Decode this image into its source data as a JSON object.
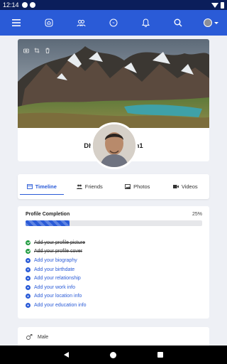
{
  "status": {
    "time": "12:14"
  },
  "appbar": {
    "icons": [
      "menu-icon",
      "home-icon",
      "friends-icon",
      "messenger-icon",
      "notifications-icon",
      "search-icon",
      "profile-menu-icon"
    ]
  },
  "profile": {
    "name": "Dhirendra Mohan1",
    "cover_tools": [
      "camera-icon",
      "crop-icon",
      "delete-icon"
    ]
  },
  "tabs": [
    {
      "label": "Timeline",
      "icon": "timeline-icon",
      "active": true
    },
    {
      "label": "Friends",
      "icon": "friends-icon",
      "active": false
    },
    {
      "label": "Photos",
      "icon": "photos-icon",
      "active": false
    },
    {
      "label": "Videos",
      "icon": "videos-icon",
      "active": false
    }
  ],
  "completion": {
    "title": "Profile Completion",
    "percent_label": "25%",
    "progress": 0.25,
    "items": [
      {
        "label": "Add your profile picture",
        "done": true
      },
      {
        "label": "Add your profile cover",
        "done": true
      },
      {
        "label": "Add your biography",
        "done": false
      },
      {
        "label": "Add your birthdate",
        "done": false
      },
      {
        "label": "Add your relationship",
        "done": false
      },
      {
        "label": "Add your work info",
        "done": false
      },
      {
        "label": "Add your location info",
        "done": false
      },
      {
        "label": "Add your education info",
        "done": false
      }
    ]
  },
  "about": {
    "gender": "Male"
  },
  "colors": {
    "brand": "#2a5bd7",
    "statusbar": "#0b1e5b",
    "success": "#1f9b3f"
  }
}
